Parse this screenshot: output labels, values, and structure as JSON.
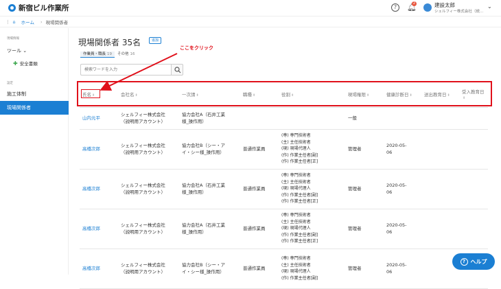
{
  "header": {
    "app_title": "新宿ビル作業所",
    "help_label": "?",
    "notification_count": "2",
    "user_name": "建設太郎",
    "user_company": "シェルフィー株式会社（説..."
  },
  "breadcrumb": {
    "home": "ホーム",
    "current": "現場関係者"
  },
  "sidebar": {
    "section_site": "現場情報",
    "tools": "ツール",
    "safety_docs": "安全書類",
    "section_settings": "設定",
    "construction": "施工体制",
    "members": "現場関係者"
  },
  "page": {
    "title": "現場関係者 35名",
    "add_button": "追加",
    "tabs": [
      {
        "label": "作業員・職長",
        "count": "19"
      },
      {
        "label": "その他",
        "count": "16"
      }
    ],
    "search_placeholder": "検索ワードを入力"
  },
  "annotation": {
    "callout": "ここをクリック"
  },
  "table": {
    "headers": [
      "氏名",
      "会社名",
      "一次請",
      "職種",
      "役割",
      "現場権限",
      "健康診断日",
      "送出教育日",
      "受入教育日"
    ],
    "rows": [
      {
        "name": "山内元平",
        "company": [
          "シェルフィー株式会社",
          "（説明用アカウント）"
        ],
        "primary": [
          "協力会社A（石井工業",
          "様_操作用）"
        ],
        "trade": "",
        "roles": [],
        "perm": "一般",
        "health": [
          "",
          ""
        ]
      },
      {
        "name": "高橋次郎",
        "company": [
          "シェルフィー株式会社",
          "（説明用アカウント）"
        ],
        "primary": [
          "協力会社B（シー・ア",
          "イ・シー様_操作用）"
        ],
        "trade": "普通作業員",
        "roles": [
          "(専) 専門技術者",
          "(主) 主任技術者",
          "(現) 現場代理人",
          "(作) 作業主任者[副]",
          "(作) 作業主任者[正]"
        ],
        "perm": "管理者",
        "health": [
          "2020-05-",
          "06"
        ]
      },
      {
        "name": "高橋次郎",
        "company": [
          "シェルフィー株式会社",
          "（説明用アカウント）"
        ],
        "primary": [
          "協力会社A（石井工業",
          "様_操作用）"
        ],
        "trade": "普通作業員",
        "roles": [
          "(専) 専門技術者",
          "(主) 主任技術者",
          "(現) 現場代理人",
          "(作) 作業主任者[副]",
          "(作) 作業主任者[正]"
        ],
        "perm": "管理者",
        "health": [
          "2020-05-",
          "06"
        ]
      },
      {
        "name": "高橋次郎",
        "company": [
          "シェルフィー株式会社",
          "（説明用アカウント）"
        ],
        "primary": [
          "協力会社A（石井工業",
          "様_操作用）"
        ],
        "trade": "普通作業員",
        "roles": [
          "(専) 専門技術者",
          "(主) 主任技術者",
          "(現) 現場代理人",
          "(作) 作業主任者[副]",
          "(作) 作業主任者[正]"
        ],
        "perm": "管理者",
        "health": [
          "2020-05-",
          "06"
        ]
      },
      {
        "name": "高橋次郎",
        "company": [
          "シェルフィー株式会社",
          "（説明用アカウント）"
        ],
        "primary": [
          "協力会社B（シー・ア",
          "イ・シー様_操作用）"
        ],
        "trade": "普通作業員",
        "roles": [
          "(専) 専門技術者",
          "(主) 主任技術者",
          "(現) 現場代理人",
          "(作) 作業主任者[副]"
        ],
        "perm": "管理者",
        "health": [
          "2020-05-",
          "06"
        ]
      }
    ]
  },
  "help_fab": "ヘルプ",
  "colors": {
    "accent": "#1b7fd3",
    "annotation": "#e0101a",
    "plus": "#3aa64b"
  }
}
